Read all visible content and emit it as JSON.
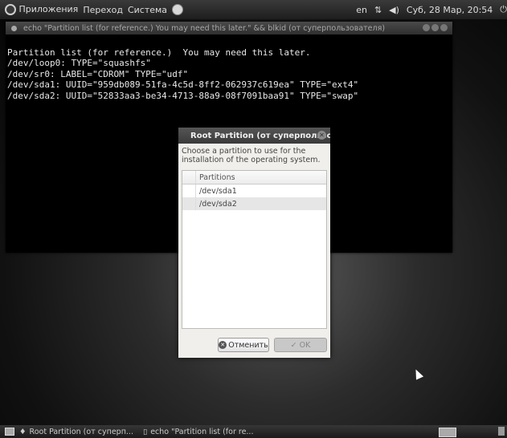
{
  "top_panel": {
    "menu_applications": "Приложения",
    "menu_places": "Переход",
    "menu_system": "Система",
    "keyboard_layout": "en",
    "clock": "Суб, 28 Мар, 20:54"
  },
  "terminal": {
    "title": "echo \"Partition list (for reference.) You may need this later.\" && blkid (от суперпользователя)",
    "lines": [
      "Partition list (for reference.)  You may need this later.",
      "/dev/loop0: TYPE=\"squashfs\"",
      "/dev/sr0: LABEL=\"CDROM\" TYPE=\"udf\"",
      "/dev/sda1: UUID=\"959db089-51fa-4c5d-8ff2-062937c619ea\" TYPE=\"ext4\"",
      "/dev/sda2: UUID=\"52833aa3-be34-4713-88a9-08f7091baa91\" TYPE=\"swap\""
    ]
  },
  "dialog": {
    "title": "Root Partition (от суперпользо",
    "prompt": "Choose a partition to use for the installation of the operating system.",
    "column_header": "Partitions",
    "rows": [
      "/dev/sda1",
      "/dev/sda2"
    ],
    "cancel_label": "Отменить",
    "ok_label": "OK"
  },
  "bottom_panel": {
    "task1": "Root Partition (от суперп...",
    "task2": "echo \"Partition list (for re..."
  }
}
